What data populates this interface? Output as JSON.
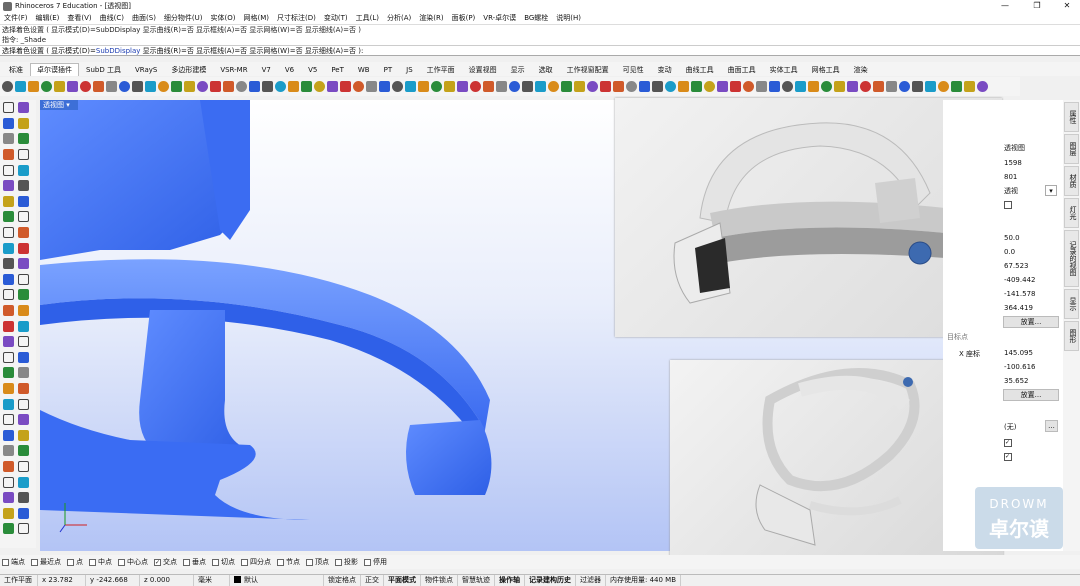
{
  "window": {
    "title": "Rhinoceros 7 Education - [透视图]"
  },
  "menu": [
    "文件(F)",
    "编辑(E)",
    "查看(V)",
    "曲线(C)",
    "曲面(S)",
    "细分物件(U)",
    "实体(O)",
    "网格(M)",
    "尺寸标注(D)",
    "变动(T)",
    "工具(L)",
    "分析(A)",
    "渲染(R)",
    "面板(P)",
    "VR-卓尔谟",
    "BG螺栓",
    "说明(H)"
  ],
  "command": {
    "history_line": "选择着色设置 ( 显示模式(D)=SubDDisplay  显示曲线(R)=否  显示框线(A)=否  显示网格(W)=否  显示细线(A)=否 )",
    "prev": "指令: _Shade",
    "prompt": "选择着色设置 ( 显示模式(D)=",
    "mode": "SubDDisplay",
    "rest": " 显示曲线(R)=否  显示框线(A)=否  显示网格(W)=否  显示细线(A)=否 ):"
  },
  "tabs": [
    "标准",
    "卓尔谟插件",
    "SubD 工具",
    "VRayS",
    "多边形建模",
    "VSR-MR",
    "V7",
    "V6",
    "V5",
    "PeT",
    "WB",
    "PT",
    "JS",
    "工作平面",
    "设置视图",
    "显示",
    "选取",
    "工作视窗配置",
    "可见性",
    "变动",
    "曲线工具",
    "曲面工具",
    "实体工具",
    "网格工具",
    "渲染"
  ],
  "active_tab": "卓尔谟插件",
  "viewport": {
    "label": "透视图"
  },
  "properties": {
    "rows1": [
      "透视图",
      "1598",
      "801",
      "透视"
    ],
    "rows2": [
      "50.0",
      "0.0",
      "67.523",
      "-409.442",
      "-141.578",
      "364.419"
    ],
    "place_btn": "放置...",
    "section_label": "目标点",
    "x_label": "X 座标",
    "target": [
      "145.095",
      "-100.616",
      "35.652"
    ],
    "place_btn2": "放置...",
    "none_value": "(无)",
    "more_btn": "..."
  },
  "right_tabs": [
    "属性",
    "图层",
    "材质",
    "灯光",
    "记录的视图",
    "显示",
    "图形"
  ],
  "osnap": [
    {
      "label": "端点",
      "checked": false
    },
    {
      "label": "最近点",
      "checked": false
    },
    {
      "label": "点",
      "checked": false
    },
    {
      "label": "中点",
      "checked": false
    },
    {
      "label": "中心点",
      "checked": false
    },
    {
      "label": "交点",
      "checked": true
    },
    {
      "label": "垂点",
      "checked": false
    },
    {
      "label": "切点",
      "checked": false
    },
    {
      "label": "四分点",
      "checked": false
    },
    {
      "label": "节点",
      "checked": false
    },
    {
      "label": "顶点",
      "checked": false
    },
    {
      "label": "投影",
      "checked": false
    },
    {
      "label": "停用",
      "checked": false
    }
  ],
  "status": {
    "plane": "工作平面",
    "x": "x 23.782",
    "y": "y -242.668",
    "z": "z 0.000",
    "unit": "毫米",
    "layer": "默认",
    "items": [
      "锁定格点",
      "正交",
      "平面模式",
      "物件锁点",
      "智慧轨迹",
      "操作轴",
      "记录建构历史",
      "过滤器"
    ],
    "bold_items": [
      "平面模式",
      "操作轴",
      "记录建构历史"
    ],
    "memory": "内存使用量: 440 MB"
  },
  "watermark": {
    "top": "DROWM",
    "bottom": "卓尔谟"
  }
}
